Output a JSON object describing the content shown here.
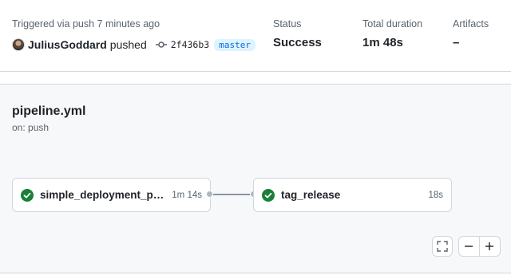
{
  "summary": {
    "trigger_text": "Triggered via push 7 minutes ago",
    "actor": "JuliusGoddard",
    "action": "pushed",
    "commit_sha": "2f436b3",
    "branch": "master",
    "status_label": "Status",
    "status_value": "Success",
    "duration_label": "Total duration",
    "duration_value": "1m 48s",
    "artifacts_label": "Artifacts",
    "artifacts_value": "–"
  },
  "workflow": {
    "file": "pipeline.yml",
    "trigger": "on: push"
  },
  "jobs": [
    {
      "name": "simple_deployment_pip...",
      "duration": "1m 14s",
      "status": "success"
    },
    {
      "name": "tag_release",
      "duration": "18s",
      "status": "success"
    }
  ],
  "colors": {
    "success": "#1a7f37",
    "branch_bg": "#ddf4ff",
    "branch_fg": "#0969da"
  },
  "controls": {
    "fullscreen_icon": "fullscreen-icon",
    "zoom_out_icon": "minus-icon",
    "zoom_in_icon": "plus-icon"
  }
}
